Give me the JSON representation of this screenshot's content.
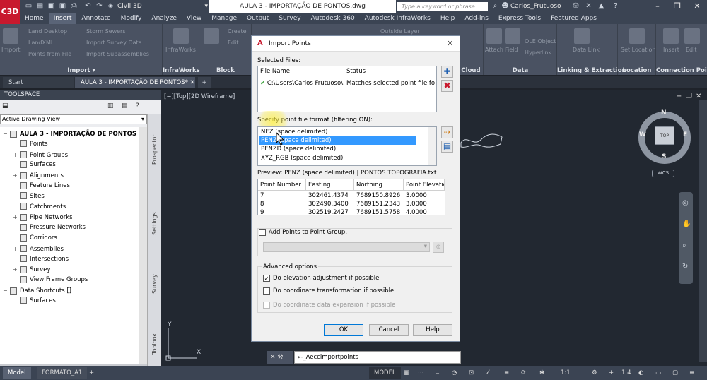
{
  "app": {
    "logo": "C3D",
    "workspace": "Civil 3D",
    "doc_title": "AULA 3 - IMPORTAÇÃO DE PONTOS.dwg",
    "search_placeholder": "Type a keyword or phrase",
    "user": "Carlos_Frutuoso",
    "accent": "#c8192e"
  },
  "ribbon_tabs": [
    "Home",
    "Insert",
    "Annotate",
    "Modify",
    "Analyze",
    "View",
    "Manage",
    "Output",
    "Survey",
    "Autodesk 360",
    "Autodesk InfraWorks",
    "Help",
    "Add-ins",
    "Express Tools",
    "Featured Apps"
  ],
  "ribbon": {
    "import_items": [
      "Land Desktop",
      "LandXML",
      "Points from File",
      "Storm Sewers",
      "Import Survey Data",
      "Import Subassemblies"
    ],
    "import_big": "Import",
    "infraworks_big": "InfraWorks",
    "panels": [
      "Import",
      "InfraWorks",
      "Block",
      "Cloud",
      "Data",
      "Linking & Extraction",
      "Location",
      "Connection Point"
    ],
    "data_items": [
      "Attach",
      "Field",
      "OLE Object",
      "Hyperlink",
      "Data Link",
      "Set Location",
      "Insert",
      "Edit"
    ],
    "block_items": [
      "Create",
      "Edit"
    ],
    "outside_layer": "Outside Layer"
  },
  "file_tabs": [
    "Start",
    "AULA 3 - IMPORTAÇÃO DE PONTOS*"
  ],
  "toolspace": {
    "title": "TOOLSPACE",
    "view": "Active Drawing View",
    "side_tabs": [
      "Prospector",
      "Settings",
      "Survey",
      "Toolbox"
    ],
    "tree": [
      {
        "label": "AULA 3 - IMPORTAÇÃO DE PONTOS",
        "level": 0,
        "bold": true,
        "exp": "−"
      },
      {
        "label": "Points",
        "level": 1,
        "exp": ""
      },
      {
        "label": "Point Groups",
        "level": 1,
        "exp": "+"
      },
      {
        "label": "Surfaces",
        "level": 1,
        "exp": ""
      },
      {
        "label": "Alignments",
        "level": 1,
        "exp": "+"
      },
      {
        "label": "Feature Lines",
        "level": 1,
        "exp": ""
      },
      {
        "label": "Sites",
        "level": 1,
        "exp": ""
      },
      {
        "label": "Catchments",
        "level": 1,
        "exp": ""
      },
      {
        "label": "Pipe Networks",
        "level": 1,
        "exp": "+"
      },
      {
        "label": "Pressure Networks",
        "level": 1,
        "exp": ""
      },
      {
        "label": "Corridors",
        "level": 1,
        "exp": ""
      },
      {
        "label": "Assemblies",
        "level": 1,
        "exp": "+"
      },
      {
        "label": "Intersections",
        "level": 1,
        "exp": ""
      },
      {
        "label": "Survey",
        "level": 1,
        "exp": "+"
      },
      {
        "label": "View Frame Groups",
        "level": 1,
        "exp": ""
      },
      {
        "label": "Data Shortcuts []",
        "level": 0,
        "exp": "−"
      },
      {
        "label": "Surfaces",
        "level": 1,
        "exp": ""
      }
    ]
  },
  "viewport": {
    "label": "[−][Top][2D Wireframe]",
    "cube_top": "TOP",
    "compass": {
      "n": "N",
      "s": "S",
      "e": "E",
      "w": "W"
    },
    "wcs": "WCS",
    "ucs_x": "X",
    "ucs_y": "Y"
  },
  "status": {
    "tabs": [
      "Model",
      "FORMATO_A1"
    ],
    "mode": "MODEL",
    "scale": "1:1",
    "zoom": "1.4"
  },
  "command": "_Aeccimportpoints",
  "dialog": {
    "title": "Import Points",
    "selected_files_label": "Selected Files:",
    "files_headers": [
      "File Name",
      "Status"
    ],
    "file_name": "C:\\Users\\Carlos Frutuoso\\...",
    "file_status": "Matches selected point file for...",
    "format_label": "Specify point file format (filtering ON):",
    "formats": [
      "NEZ (space delimited)",
      "PENZ (space delimited)",
      "PENZD (space delimited)",
      "XYZ_RGB (space delimited)"
    ],
    "selected_format_index": 1,
    "preview_label": "Preview: PENZ (space delimited) | PONTOS TOPOGRAFIA.txt",
    "preview_headers": [
      "Point Number",
      "Easting",
      "Northing",
      "Point Elevation"
    ],
    "preview_rows": [
      [
        "7",
        "302461.4374",
        "7689150.8926",
        "3.0000"
      ],
      [
        "8",
        "302490.3400",
        "7689151.2343",
        "3.0000"
      ],
      [
        "9",
        "302519.2427",
        "7689151.5758",
        "4.0000"
      ]
    ],
    "add_to_group": "Add Points to Point Group.",
    "advanced_label": "Advanced options",
    "opt_elevation": "Do elevation adjustment if possible",
    "opt_coord": "Do coordinate transformation if possible",
    "opt_expansion": "Do coordinate data expansion if possible",
    "ok": "OK",
    "cancel": "Cancel",
    "help": "Help"
  }
}
